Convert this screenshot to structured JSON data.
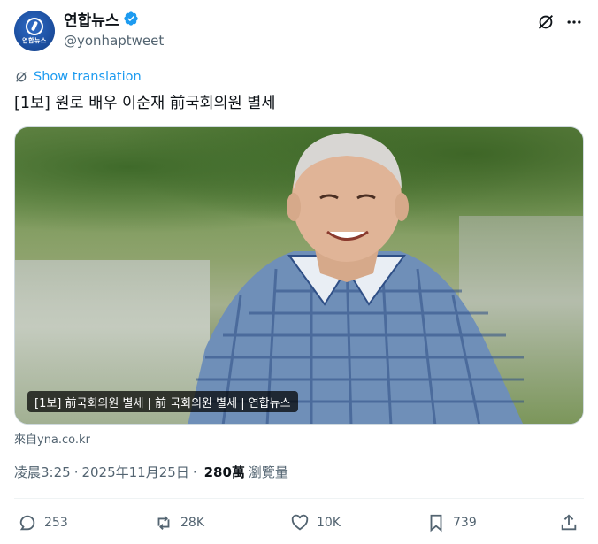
{
  "author": {
    "display_name": "연합뉴스",
    "handle": "@yonhaptweet",
    "avatar_text": "연합뉴스"
  },
  "translate_label": "Show translation",
  "tweet_text": "[1보] 원로 배우 이순재 前국회의원 별세",
  "media": {
    "caption": "[1보] 前국회의원 별세 | 前 국회의원 별세 | 연합뉴스"
  },
  "card_source": "來自yna.co.kr",
  "meta": {
    "time": "凌晨3:25",
    "separator": "·",
    "date": "2025年11月25日",
    "separator2": "·",
    "views_count": "280萬",
    "views_label": "瀏覽量"
  },
  "actions": {
    "replies": "253",
    "reposts": "28K",
    "likes": "10K",
    "bookmarks": "739"
  },
  "icons": [
    "verified-badge-icon",
    "grok-icon",
    "more-icon",
    "translate-icon",
    "reply-icon",
    "repost-icon",
    "like-icon",
    "bookmark-icon",
    "share-icon"
  ],
  "colors": {
    "accent": "#1d9bf0",
    "text": "#0f1419",
    "muted": "#536471"
  }
}
